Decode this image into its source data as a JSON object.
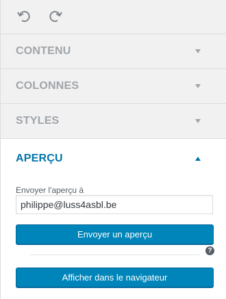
{
  "toolbar": {
    "undo_icon": "undo-icon",
    "redo_icon": "redo-icon"
  },
  "sections": [
    {
      "label": "CONTENU",
      "expanded": false
    },
    {
      "label": "COLONNES",
      "expanded": false
    },
    {
      "label": "STYLES",
      "expanded": false
    },
    {
      "label": "APERÇU",
      "expanded": true
    }
  ],
  "preview": {
    "email_label": "Envoyer l'aperçu à",
    "email_value": "philippe@luss4asbl.be",
    "send_button": "Envoyer un aperçu",
    "help_glyph": "?",
    "browser_button": "Afficher dans le navigateur"
  },
  "colors": {
    "accent": "#0073aa",
    "button": "#0085ba",
    "muted": "#a0a5aa"
  }
}
